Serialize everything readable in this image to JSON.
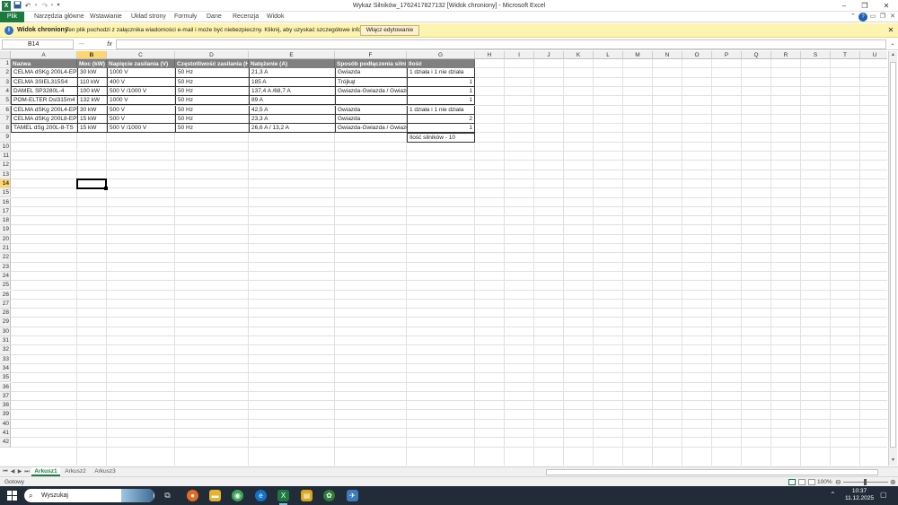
{
  "window": {
    "title": "Wykaz Silników_1762417827132  [Widok chroniony]  -  Microsoft Excel",
    "controls": [
      "–",
      "❐",
      "✕"
    ]
  },
  "quick_access": {
    "save_icon": "save-icon",
    "undo_icon": "undo-icon",
    "redo_icon": "redo-icon",
    "customize": "▾"
  },
  "ribbon": {
    "file_tab": "Plik",
    "tabs": [
      "Narzędzia główne",
      "Wstawianie",
      "Układ strony",
      "Formuły",
      "Dane",
      "Recenzja",
      "Widok"
    ]
  },
  "message_bar": {
    "title": "Widok chroniony",
    "text": "Ten plik pochodzi z załącznika wiadomości e-mail i może być niebezpieczny. Kliknij, aby uzyskać szczegółowe informacje.",
    "button": "Włącz edytowanie",
    "close": "✕",
    "color": "#fdf4b0"
  },
  "formula_bar": {
    "name_box": "B14",
    "fx": "fx",
    "value": ""
  },
  "sheet": {
    "columns": [
      "A",
      "B",
      "C",
      "D",
      "E",
      "F",
      "G",
      "H",
      "I",
      "J",
      "K",
      "L",
      "M",
      "N",
      "O",
      "P",
      "Q",
      "R",
      "S",
      "T",
      "U"
    ],
    "selected_column": "B",
    "selected_row": 14,
    "row_count": 42,
    "header_row": [
      "Nazwa",
      "Moc (kW)",
      "Napięcie zasilania (V)",
      "Częstotliwość zasilania (Hz)",
      "Natężenie (A)",
      "Sposób podłączenia silnika",
      "Ilość"
    ],
    "rows": [
      [
        "CELMA dSKg 200L4-EP",
        "30 kW",
        "1000 V",
        "50 Hz",
        "21,3 A",
        "Gwiazda",
        "1 działa i 1 nie działa"
      ],
      [
        "CELMA 3SIEL315S4",
        "110 kW",
        "400 V",
        "50 Hz",
        "185 A",
        "Trójkąt",
        "1"
      ],
      [
        "DAMEL SP3280L-4",
        "100 kW",
        "500 V /1000 V",
        "50 Hz",
        "137,4 A /68,7 A",
        "Gwiazda-Gwiazda / Gwiazda",
        "1"
      ],
      [
        "POM-ELTER Dsl315m4",
        "132 kW",
        "1000 V",
        "50 Hz",
        "89 A",
        "",
        "1"
      ],
      [
        "CELMA dSKg 200L4-EP",
        "30 kW",
        "500 V",
        "50 Hz",
        "42,5 A",
        "Gwiazda",
        "1 działa i 1 nie działa"
      ],
      [
        "CELMA dSKg 200L8-EP",
        "15 kW",
        "500 V",
        "50 Hz",
        "23,3 A",
        "Gwiazda",
        "2"
      ],
      [
        "TAMEL dSg 200L-8-TS",
        "15 kW",
        "500 V /1000 V",
        "50 Hz",
        "26,6 A / 13,2 A",
        "Gwiazda-Gwiazda / Gwiazda",
        "1"
      ]
    ],
    "total_label": "Ilość silników - 10",
    "header_fill": "#808080"
  },
  "sheet_tabs": [
    "Arkusz1",
    "Arkusz2",
    "Arkusz3"
  ],
  "active_sheet": "Arkusz1",
  "status": {
    "text": "Gotowy",
    "zoom": "100%"
  },
  "taskbar": {
    "search_placeholder": "Wyszukaj",
    "time": "10:37",
    "date": "11.12.2025"
  }
}
